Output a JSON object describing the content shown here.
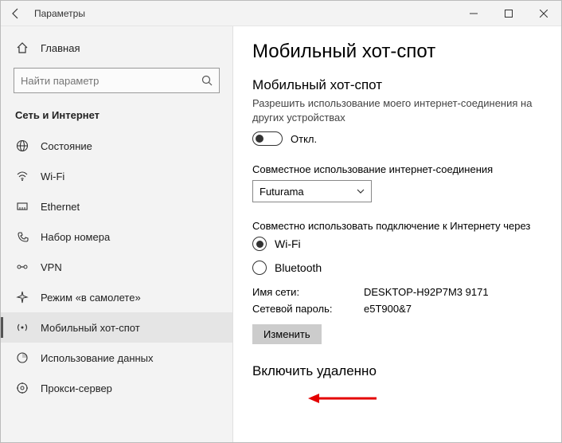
{
  "window": {
    "title": "Параметры"
  },
  "sidebar": {
    "home": "Главная",
    "search_placeholder": "Найти параметр",
    "section": "Сеть и Интернет",
    "items": [
      {
        "label": "Состояние"
      },
      {
        "label": "Wi-Fi"
      },
      {
        "label": "Ethernet"
      },
      {
        "label": "Набор номера"
      },
      {
        "label": "VPN"
      },
      {
        "label": "Режим «в самолете»"
      },
      {
        "label": "Мобильный хот-спот"
      },
      {
        "label": "Использование данных"
      },
      {
        "label": "Прокси-сервер"
      }
    ]
  },
  "content": {
    "title": "Мобильный хот-спот",
    "hotspot_heading": "Мобильный хот-спот",
    "hotspot_desc": "Разрешить использование моего интернет-соединения на других устройствах",
    "toggle_state": "Откл.",
    "share_label": "Совместное использование интернет-соединения",
    "share_value": "Futurama",
    "via_label": "Совместно использовать подключение к Интернету через",
    "radio_wifi": "Wi-Fi",
    "radio_bt": "Bluetooth",
    "net_name_label": "Имя сети:",
    "net_name_value": "DESKTOP-H92P7M3 9171",
    "net_pass_label": "Сетевой пароль:",
    "net_pass_value": "e5T900&7",
    "edit_button": "Изменить",
    "remote_heading": "Включить удаленно"
  }
}
